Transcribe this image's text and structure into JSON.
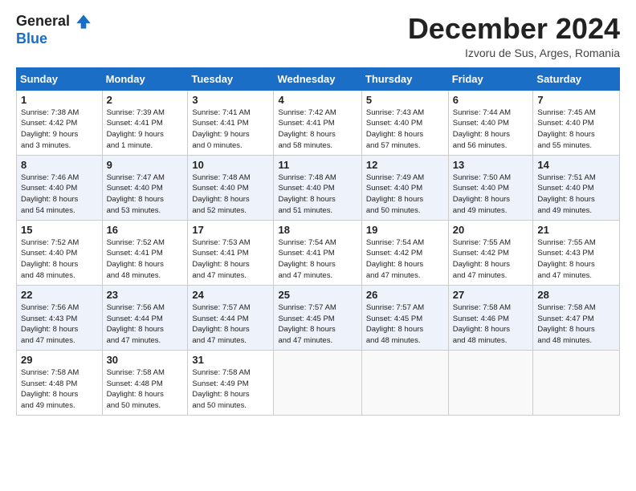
{
  "header": {
    "logo_line1": "General",
    "logo_line2": "Blue",
    "month_title": "December 2024",
    "location": "Izvoru de Sus, Arges, Romania"
  },
  "days_of_week": [
    "Sunday",
    "Monday",
    "Tuesday",
    "Wednesday",
    "Thursday",
    "Friday",
    "Saturday"
  ],
  "weeks": [
    [
      {
        "day": "1",
        "info": "Sunrise: 7:38 AM\nSunset: 4:42 PM\nDaylight: 9 hours\nand 3 minutes."
      },
      {
        "day": "2",
        "info": "Sunrise: 7:39 AM\nSunset: 4:41 PM\nDaylight: 9 hours\nand 1 minute."
      },
      {
        "day": "3",
        "info": "Sunrise: 7:41 AM\nSunset: 4:41 PM\nDaylight: 9 hours\nand 0 minutes."
      },
      {
        "day": "4",
        "info": "Sunrise: 7:42 AM\nSunset: 4:41 PM\nDaylight: 8 hours\nand 58 minutes."
      },
      {
        "day": "5",
        "info": "Sunrise: 7:43 AM\nSunset: 4:40 PM\nDaylight: 8 hours\nand 57 minutes."
      },
      {
        "day": "6",
        "info": "Sunrise: 7:44 AM\nSunset: 4:40 PM\nDaylight: 8 hours\nand 56 minutes."
      },
      {
        "day": "7",
        "info": "Sunrise: 7:45 AM\nSunset: 4:40 PM\nDaylight: 8 hours\nand 55 minutes."
      }
    ],
    [
      {
        "day": "8",
        "info": "Sunrise: 7:46 AM\nSunset: 4:40 PM\nDaylight: 8 hours\nand 54 minutes."
      },
      {
        "day": "9",
        "info": "Sunrise: 7:47 AM\nSunset: 4:40 PM\nDaylight: 8 hours\nand 53 minutes."
      },
      {
        "day": "10",
        "info": "Sunrise: 7:48 AM\nSunset: 4:40 PM\nDaylight: 8 hours\nand 52 minutes."
      },
      {
        "day": "11",
        "info": "Sunrise: 7:48 AM\nSunset: 4:40 PM\nDaylight: 8 hours\nand 51 minutes."
      },
      {
        "day": "12",
        "info": "Sunrise: 7:49 AM\nSunset: 4:40 PM\nDaylight: 8 hours\nand 50 minutes."
      },
      {
        "day": "13",
        "info": "Sunrise: 7:50 AM\nSunset: 4:40 PM\nDaylight: 8 hours\nand 49 minutes."
      },
      {
        "day": "14",
        "info": "Sunrise: 7:51 AM\nSunset: 4:40 PM\nDaylight: 8 hours\nand 49 minutes."
      }
    ],
    [
      {
        "day": "15",
        "info": "Sunrise: 7:52 AM\nSunset: 4:40 PM\nDaylight: 8 hours\nand 48 minutes."
      },
      {
        "day": "16",
        "info": "Sunrise: 7:52 AM\nSunset: 4:41 PM\nDaylight: 8 hours\nand 48 minutes."
      },
      {
        "day": "17",
        "info": "Sunrise: 7:53 AM\nSunset: 4:41 PM\nDaylight: 8 hours\nand 47 minutes."
      },
      {
        "day": "18",
        "info": "Sunrise: 7:54 AM\nSunset: 4:41 PM\nDaylight: 8 hours\nand 47 minutes."
      },
      {
        "day": "19",
        "info": "Sunrise: 7:54 AM\nSunset: 4:42 PM\nDaylight: 8 hours\nand 47 minutes."
      },
      {
        "day": "20",
        "info": "Sunrise: 7:55 AM\nSunset: 4:42 PM\nDaylight: 8 hours\nand 47 minutes."
      },
      {
        "day": "21",
        "info": "Sunrise: 7:55 AM\nSunset: 4:43 PM\nDaylight: 8 hours\nand 47 minutes."
      }
    ],
    [
      {
        "day": "22",
        "info": "Sunrise: 7:56 AM\nSunset: 4:43 PM\nDaylight: 8 hours\nand 47 minutes."
      },
      {
        "day": "23",
        "info": "Sunrise: 7:56 AM\nSunset: 4:44 PM\nDaylight: 8 hours\nand 47 minutes."
      },
      {
        "day": "24",
        "info": "Sunrise: 7:57 AM\nSunset: 4:44 PM\nDaylight: 8 hours\nand 47 minutes."
      },
      {
        "day": "25",
        "info": "Sunrise: 7:57 AM\nSunset: 4:45 PM\nDaylight: 8 hours\nand 47 minutes."
      },
      {
        "day": "26",
        "info": "Sunrise: 7:57 AM\nSunset: 4:45 PM\nDaylight: 8 hours\nand 48 minutes."
      },
      {
        "day": "27",
        "info": "Sunrise: 7:58 AM\nSunset: 4:46 PM\nDaylight: 8 hours\nand 48 minutes."
      },
      {
        "day": "28",
        "info": "Sunrise: 7:58 AM\nSunset: 4:47 PM\nDaylight: 8 hours\nand 48 minutes."
      }
    ],
    [
      {
        "day": "29",
        "info": "Sunrise: 7:58 AM\nSunset: 4:48 PM\nDaylight: 8 hours\nand 49 minutes."
      },
      {
        "day": "30",
        "info": "Sunrise: 7:58 AM\nSunset: 4:48 PM\nDaylight: 8 hours\nand 50 minutes."
      },
      {
        "day": "31",
        "info": "Sunrise: 7:58 AM\nSunset: 4:49 PM\nDaylight: 8 hours\nand 50 minutes."
      },
      null,
      null,
      null,
      null
    ]
  ]
}
